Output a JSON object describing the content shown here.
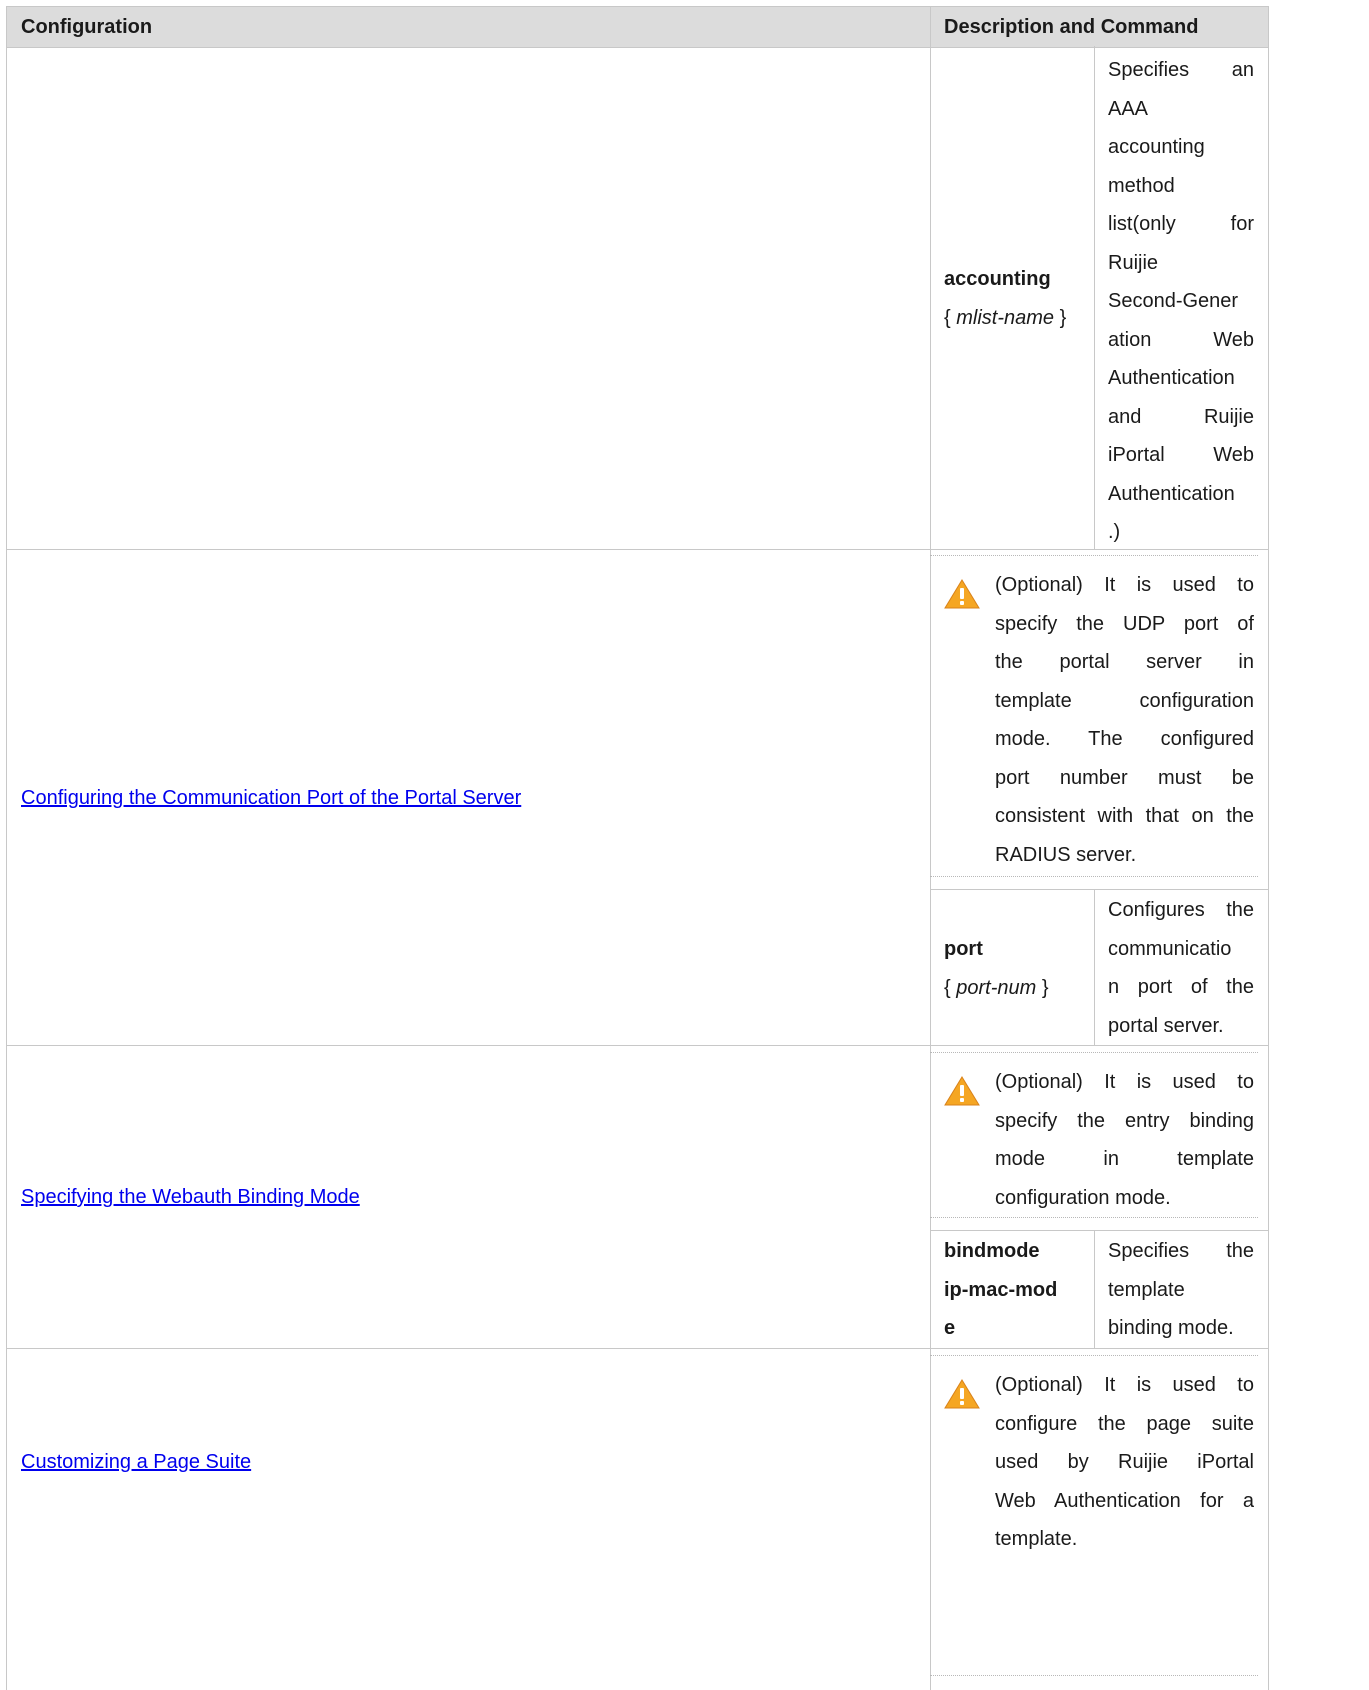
{
  "header": {
    "col1": "Configuration",
    "col2": "Description and Command"
  },
  "rows": {
    "accounting": {
      "command_keyword": "accounting",
      "command_arg": "mlist-name",
      "description_lines": [
        "Specifies an",
        "AAA",
        "accounting",
        "method",
        "list(only for",
        "Ruijie",
        "Second-Gener",
        "ation Web",
        "Authentication",
        "and Ruijie",
        "iPortal Web",
        "Authentication",
        ".)"
      ]
    },
    "port": {
      "link": "Configuring the Communication Port of the Portal Server",
      "note_lines": [
        "(Optional) It is used to",
        "specify the UDP port of",
        "the portal server in",
        "template configuration",
        "mode. The configured",
        "port number must be",
        "consistent with that on the",
        "RADIUS server."
      ],
      "command_keyword": "port",
      "command_arg": "port-num",
      "description_lines": [
        "Configures the",
        "communicatio",
        "n port of the",
        "portal server."
      ]
    },
    "bindmode": {
      "link": "Specifying the Webauth Binding Mode",
      "note_lines": [
        "(Optional) It is used to",
        "specify the entry binding",
        "mode in template",
        "configuration mode."
      ],
      "command_lines": [
        "bindmode",
        "ip-mac-mod",
        "e"
      ],
      "description_lines": [
        "Specifies the",
        "template",
        "binding mode."
      ]
    },
    "page_suite": {
      "link": "Customizing a Page Suite",
      "note_lines": [
        "(Optional) It is used to",
        "configure the page suite",
        "used by Ruijie iPortal",
        "Web Authentication for a",
        "template."
      ]
    }
  },
  "colors": {
    "link": "#0000ee",
    "header_bg": "#dcdcdc",
    "border": "#c8c8c8",
    "warning": "#f5a623"
  },
  "icons": {
    "warning": "warning-triangle-icon"
  }
}
